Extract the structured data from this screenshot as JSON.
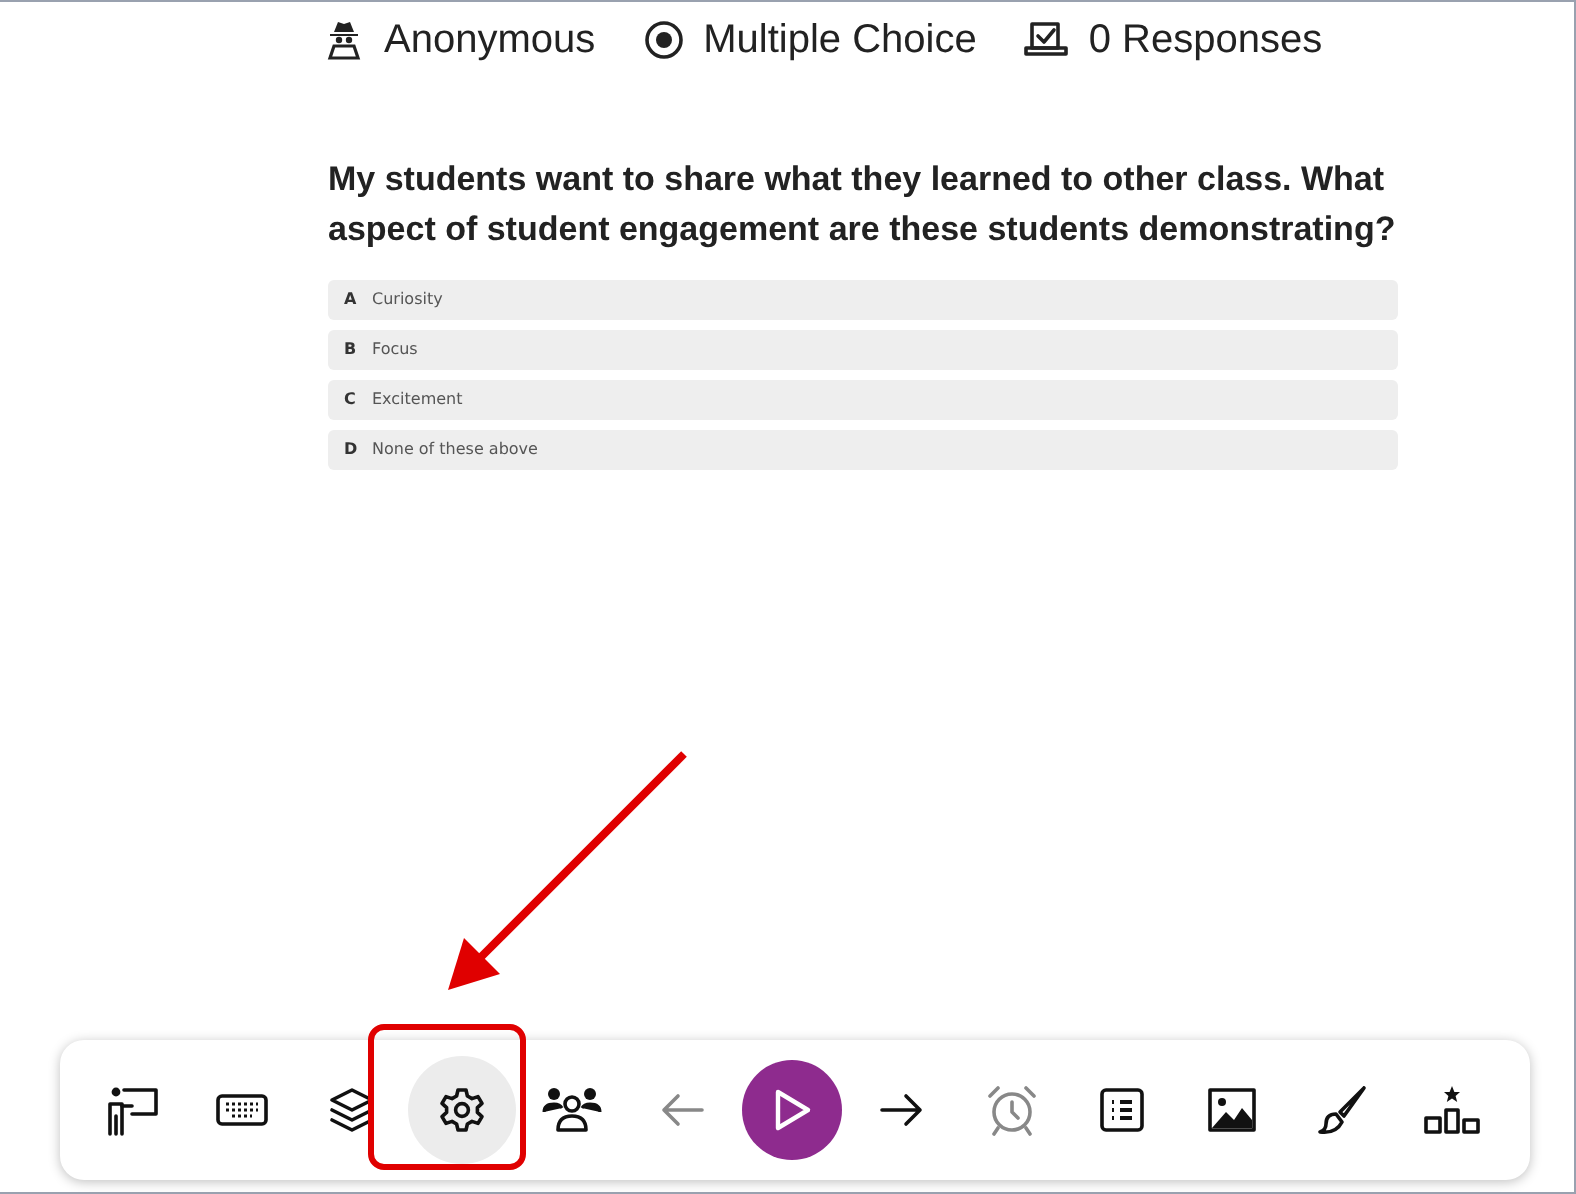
{
  "meta": [
    {
      "kind": "anonymous",
      "label": "Anonymous"
    },
    {
      "kind": "multiple-choice",
      "label": "Multiple Choice"
    },
    {
      "kind": "responses",
      "label": "0 Responses"
    }
  ],
  "question": "My students want to share what they learned to other class. What aspect of student engagement are these students demonstrating?",
  "options": [
    {
      "letter": "A",
      "text": "Curiosity"
    },
    {
      "letter": "B",
      "text": "Focus"
    },
    {
      "letter": "C",
      "text": "Excitement"
    },
    {
      "letter": "D",
      "text": "None of these above"
    }
  ],
  "toolbar": [
    {
      "kind": "presenter",
      "selected": false,
      "disabled": false
    },
    {
      "kind": "keyboard",
      "selected": false,
      "disabled": false
    },
    {
      "kind": "layers",
      "selected": false,
      "disabled": false
    },
    {
      "kind": "settings",
      "selected": true,
      "disabled": false
    },
    {
      "kind": "people",
      "selected": false,
      "disabled": false
    },
    {
      "kind": "back",
      "selected": false,
      "disabled": true
    },
    {
      "kind": "play",
      "selected": false,
      "disabled": false
    },
    {
      "kind": "forward",
      "selected": false,
      "disabled": false
    },
    {
      "kind": "alarm",
      "selected": false,
      "disabled": true
    },
    {
      "kind": "list",
      "selected": false,
      "disabled": false
    },
    {
      "kind": "image",
      "selected": false,
      "disabled": false
    },
    {
      "kind": "brush",
      "selected": false,
      "disabled": false
    },
    {
      "kind": "podium",
      "selected": false,
      "disabled": false
    }
  ]
}
